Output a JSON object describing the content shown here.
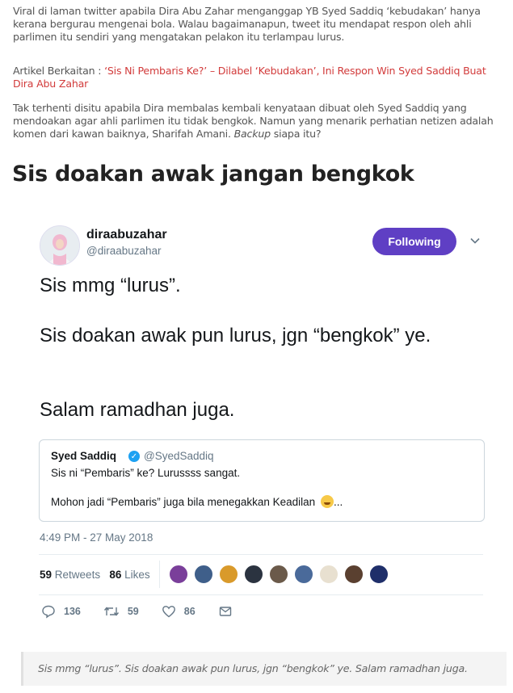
{
  "article": {
    "para1": "Viral di laman twitter apabila Dira Abu Zahar menganggap YB Syed Saddiq ‘kebudakan’ hanya kerana bergurau mengenai bola. Walau bagaimanapun, tweet itu mendapat respon oleh ahli parlimen itu sendiri yang mengatakan pelakon itu terlampau lurus.",
    "related_prefix": "Artikel Berkaitan : ",
    "related_link": "‘Sis Ni Pembaris Ke?’ – Dilabel ‘Kebudakan’, Ini Respon Win Syed Saddiq Buat Dira Abu Zahar",
    "para3_start": "Tak terhenti disitu apabila Dira membalas kembali kenyataan dibuat oleh Syed Saddiq yang mendoakan agar ahli parlimen itu tidak bengkok. Namun yang menarik perhatian netizen adalah komen dari kawan baiknya, Sharifah Amani. ",
    "para3_italic": "Backup",
    "para3_end": " siapa itu?",
    "heading": "Sis doakan awak jangan bengkok",
    "caption": "Sis mmg “lurus”. Sis doakan awak pun lurus, jgn “bengkok” ye. Salam ramadhan juga."
  },
  "tweet": {
    "name": "diraabuzahar",
    "handle": "@diraabuzahar",
    "follow_label": "Following",
    "line1": "Sis mmg “lurus”.",
    "line2": "Sis doakan awak pun lurus, jgn “bengkok” ye.",
    "line3": "Salam ramadhan juga.",
    "timestamp": "4:49 PM - 27 May 2018",
    "retweets_count": "59",
    "retweets_label": "Retweets",
    "likes_count": "86",
    "likes_label": "Likes",
    "reply_count": "136",
    "retweet_action_count": "59",
    "like_action_count": "86",
    "accent_color": "#5f3fc4",
    "quoted": {
      "name": "Syed Saddiq",
      "handle": "@SyedSaddiq",
      "line1": "Sis ni “Pembaris” ke? Lurussss sangat.",
      "line2": "Mohon jadi “Pembaris” juga bila menegakkan Keadilan",
      "ellipsis": "..."
    },
    "liker_colors": [
      "#7a3f9a",
      "#3f5f8a",
      "#d99a2b",
      "#2b3340",
      "#6b5a4a",
      "#4a6a9a",
      "#e8e0d0",
      "#5a4030",
      "#1f2f6a"
    ]
  }
}
